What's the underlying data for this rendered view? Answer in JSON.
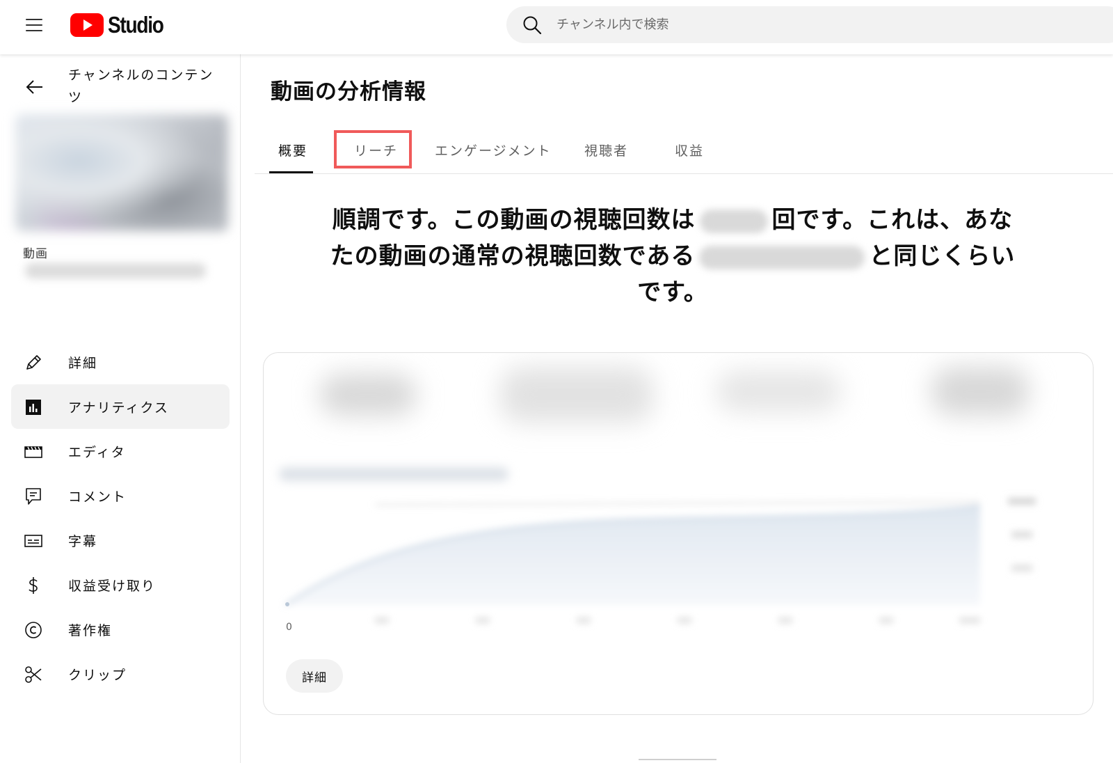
{
  "app": {
    "logo_text": "Studio",
    "brand_color": "#ff0000"
  },
  "search": {
    "placeholder": "チャンネル内で検索"
  },
  "sidebar": {
    "back_label": "チャンネルのコンテンツ",
    "video_heading": "動画",
    "items": [
      {
        "label": "詳細",
        "icon": "pencil-icon",
        "active": false
      },
      {
        "label": "アナリティクス",
        "icon": "analytics-icon",
        "active": true
      },
      {
        "label": "エディタ",
        "icon": "clapperboard-icon",
        "active": false
      },
      {
        "label": "コメント",
        "icon": "comment-icon",
        "active": false
      },
      {
        "label": "字幕",
        "icon": "subtitles-icon",
        "active": false
      },
      {
        "label": "収益受け取り",
        "icon": "dollar-icon",
        "active": false
      },
      {
        "label": "著作権",
        "icon": "copyright-icon",
        "active": false
      },
      {
        "label": "クリップ",
        "icon": "scissors-icon",
        "active": false
      }
    ]
  },
  "main": {
    "title": "動画の分析情報",
    "tabs": [
      {
        "label": "概要",
        "active": true
      },
      {
        "label": "リーチ",
        "active": false,
        "highlighted": true
      },
      {
        "label": "エンゲージメント",
        "active": false
      },
      {
        "label": "視聴者",
        "active": false
      },
      {
        "label": "収益",
        "active": false
      }
    ],
    "highlight_color": "#f05a5a",
    "summary": {
      "part1": "順調です。この動画の視聴回数は",
      "part2": "回です。これは、あなたの動画の通常の視聴回数である",
      "part3": "と同じくらいです。"
    },
    "card": {
      "axis_zero": "0",
      "detail_button": "詳細"
    }
  }
}
